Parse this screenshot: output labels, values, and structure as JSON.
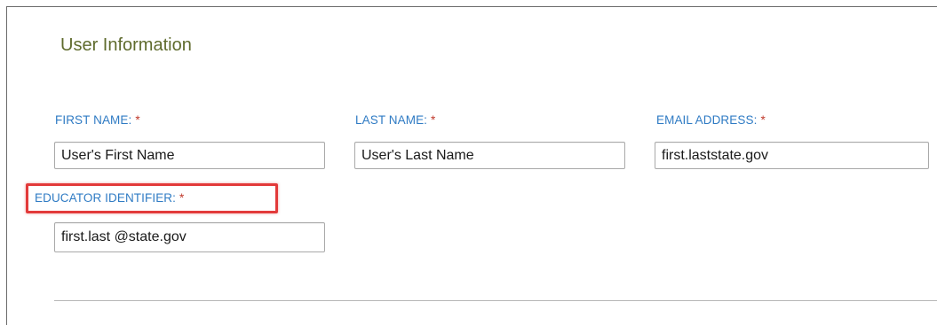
{
  "section": {
    "title": "User Information"
  },
  "fields": {
    "first_name": {
      "label": "FIRST NAME:",
      "required_mark": "*",
      "value": "User's First Name"
    },
    "last_name": {
      "label": "LAST NAME:",
      "required_mark": "*",
      "value": "User's Last Name"
    },
    "email": {
      "label": "EMAIL ADDRESS:",
      "required_mark": "*",
      "value": "first.laststate.gov"
    },
    "educator_identifier": {
      "label": "EDUCATOR IDENTIFIER:",
      "required_mark": "*",
      "value": "first.last @state.gov"
    }
  },
  "colors": {
    "label": "#2f7bc4",
    "required": "#c0392b",
    "title": "#5f6b2d",
    "highlight": "#e23a3a"
  }
}
